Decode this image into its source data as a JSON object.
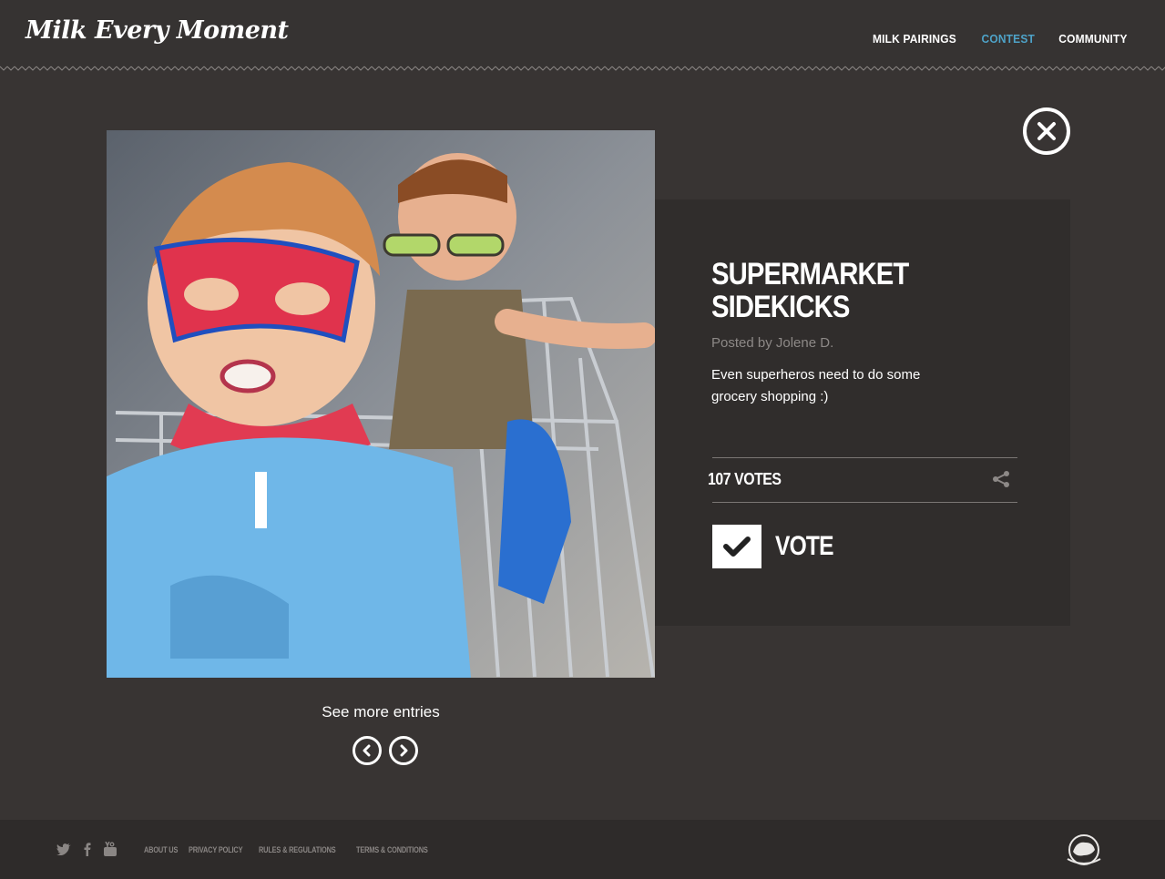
{
  "header": {
    "logo": "Milk Every Moment",
    "nav": [
      {
        "label": "MILK PAIRINGS",
        "active": false
      },
      {
        "label": "CONTEST",
        "active": true
      },
      {
        "label": "COMMUNITY",
        "active": false
      }
    ],
    "accent_color": "#4ea3c8"
  },
  "entry": {
    "title": "SUPERMARKET SIDEKICKS",
    "posted_by": "Posted by Jolene D.",
    "description": "Even superheros need to do some grocery shopping :)",
    "votes": "107 VOTES",
    "vote_label": "VOTE"
  },
  "pager": {
    "see_more": "See more entries"
  },
  "footer": {
    "links": [
      "ABOUT US",
      "PRIVACY POLICY",
      "RULES & REGULATIONS",
      "TERMS & CONDITIONS"
    ],
    "social_icons": [
      "twitter-icon",
      "facebook-icon",
      "youtube-icon"
    ]
  }
}
